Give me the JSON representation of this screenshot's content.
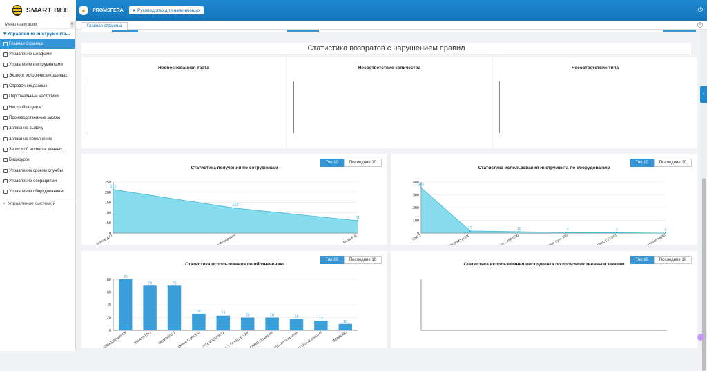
{
  "header": {
    "logo_text": "SMART BEE",
    "org_name": "PROMSFERA",
    "guide_label": "Руководство для начинающих"
  },
  "sidebar": {
    "title": "Меню навигации",
    "collapse_glyph": "«",
    "group_label": "Управление инструмента...",
    "items": [
      {
        "label": "Главная страница",
        "active": true
      },
      {
        "label": "Управление шкафами"
      },
      {
        "label": "Управление инструментами"
      },
      {
        "label": "Экспорт исторических данных"
      },
      {
        "label": "Справочник данных"
      },
      {
        "label": "Персональные настройки"
      },
      {
        "label": "Настройка цехов"
      },
      {
        "label": "Производственные заказы"
      },
      {
        "label": "Заявка на выдачу"
      },
      {
        "label": "Заявки на пополнение"
      },
      {
        "label": "Записи об экспорте данных ..."
      },
      {
        "label": "Видеоурок"
      },
      {
        "label": "Управление сроком службы"
      },
      {
        "label": "Управление операциями"
      },
      {
        "label": "Управление оборудованием"
      }
    ],
    "system_label": "Управление системой"
  },
  "tabs": {
    "active": "Главная страница"
  },
  "returns": {
    "title": "Статистика возвратов с нарушением правил",
    "panels": [
      "Необоснованная трата",
      "Несоответствие количества",
      "Несоответствие типа"
    ]
  },
  "toggles": {
    "top": "Топ 10",
    "last": "Последние 10"
  },
  "chart_data": [
    {
      "type": "area",
      "title": "Статистика получений по сотрудникам",
      "categories": [
        "Зуйков Д.О.",
        "Зимин Фёдорович",
        "Муха В.А."
      ],
      "values": [
        213,
        122,
        61
      ],
      "ylim": [
        0,
        250
      ],
      "yticks": [
        0,
        50,
        100,
        150,
        200,
        250
      ]
    },
    {
      "type": "area",
      "title": "Статистика использования инструмента по оборудованию",
      "categories": [
        "CNC1",
        "Hison TE30M1x1000",
        "Solution DNM4500",
        "Solution Lynx 300",
        "DMG CTX510",
        "Hsison H630"
      ],
      "values": [
        355,
        17,
        11,
        5,
        3,
        0
      ],
      "ylim": [
        0,
        400
      ],
      "yticks": [
        0,
        100,
        200,
        300,
        400
      ]
    },
    {
      "type": "bar",
      "title": "Статистика использования по обозначению",
      "categories": [
        "VNMG160408-SF",
        "16ER200ISO",
        "MGMN300-T",
        "фреза С (P+3,5)",
        "PCLNR2020K12",
        "1/4 x 14 H5S E VAP",
        "CNMG120408-PF",
        "HSS без покрытия",
        "R4141x20x22 BRIGHT",
        "MGMN400"
      ],
      "values": [
        80,
        70,
        70,
        26,
        23,
        20,
        20,
        18,
        15,
        10
      ],
      "ylim": [
        0,
        80
      ],
      "yticks": [
        0,
        20,
        40,
        60,
        80
      ]
    },
    {
      "type": "line",
      "title": "Статистика использования инструмента по производственным заказам",
      "categories": [],
      "values": []
    }
  ]
}
